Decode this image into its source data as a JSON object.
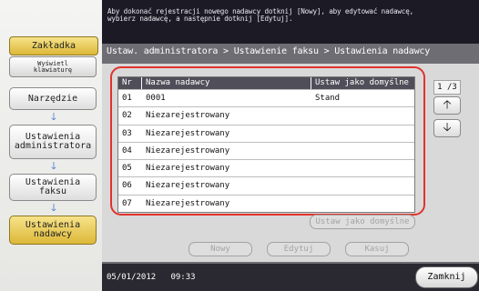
{
  "instruction": "Aby dokonać rejestracji nowego nadawcy dotknij [Nowy], aby edytować nadawcę,\nwybierz nadawcę, a następnie dotknij [Edytuj].",
  "sidebar": {
    "bookmark_tab": "Zakładka",
    "keyboard_tab": "Wyświetl\nklawiaturę",
    "path": [
      {
        "label": "Narzędzie"
      },
      {
        "label": "Ustawienia administratora"
      },
      {
        "label": "Ustawienia faksu"
      },
      {
        "label": "Ustawienia nadawcy"
      }
    ]
  },
  "breadcrumb": "Ustaw. administratora > Ustawienie faksu > Ustawienia nadawcy",
  "table": {
    "headers": [
      "Nr",
      "Nazwa nadawcy",
      "Ustaw jako domyślne"
    ],
    "rows": [
      {
        "nr": "01",
        "name": "0001",
        "default": "Stand"
      },
      {
        "nr": "02",
        "name": "Niezarejestrowany",
        "default": ""
      },
      {
        "nr": "03",
        "name": "Niezarejestrowany",
        "default": ""
      },
      {
        "nr": "04",
        "name": "Niezarejestrowany",
        "default": ""
      },
      {
        "nr": "05",
        "name": "Niezarejestrowany",
        "default": ""
      },
      {
        "nr": "06",
        "name": "Niezarejestrowany",
        "default": ""
      },
      {
        "nr": "07",
        "name": "Niezarejestrowany",
        "default": ""
      }
    ]
  },
  "pager": {
    "label": "1 /3",
    "up_icon": "arrow-up-icon",
    "down_icon": "arrow-down-icon"
  },
  "actions": {
    "set_default": "Ustaw jako domyślne",
    "new": "Nowy",
    "edit": "Edytuj",
    "delete": "Kasuj"
  },
  "status": {
    "date": "05/01/2012",
    "time": "09:33"
  },
  "close_label": "Zamknij",
  "colors": {
    "highlight": "#e0332b",
    "active_tab": "#ddb838",
    "arrow": "#2a64c8",
    "header": "#504e58"
  }
}
